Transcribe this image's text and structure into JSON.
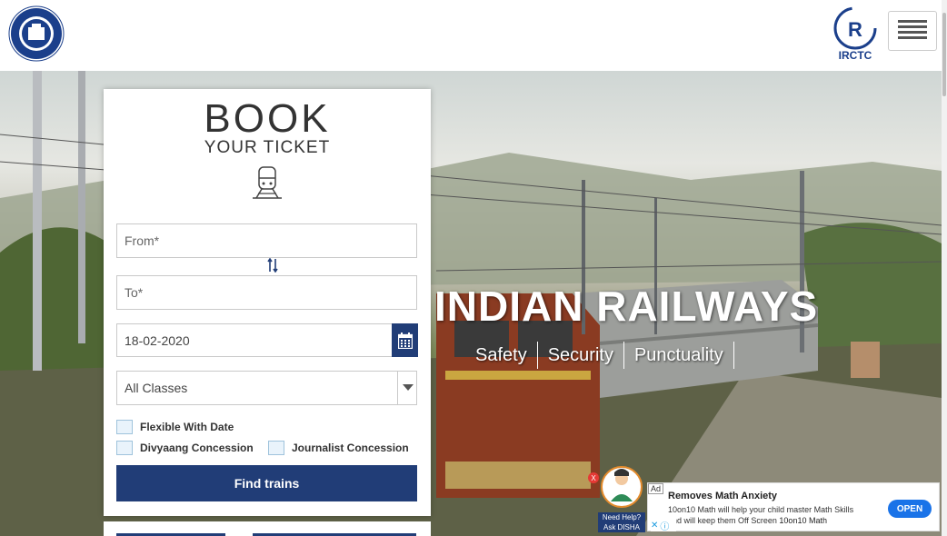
{
  "header": {
    "logo_left": "indian-railways-emblem",
    "logo_right_text": "IRCTC",
    "menu_icon": "hamburger-icon"
  },
  "hero": {
    "title": "INDIAN RAILWAYS",
    "taglines": [
      "Safety",
      "Security",
      "Punctuality"
    ]
  },
  "booking": {
    "title": "BOOK",
    "subtitle": "YOUR TICKET",
    "from_placeholder": "From*",
    "to_placeholder": "To*",
    "date_value": "18-02-2020",
    "class_value": "All Classes",
    "checkboxes": {
      "flexible": "Flexible With Date",
      "divyaang": "Divyaang Concession",
      "journalist": "Journalist Concession"
    },
    "find_button": "Find trains"
  },
  "disha": {
    "close_label": "X",
    "text_line1": "Need Help?",
    "text_line2": "Ask DISHA"
  },
  "ad": {
    "tag": "Ad",
    "title": "Removes Math Anxiety",
    "desc_line1": "10on10 Math will help your child master Math Skills",
    "desc_line2": "and will keep them Off Screen",
    "brand": "10on10 Math",
    "open_label": "OPEN"
  },
  "colors": {
    "brand_navy": "#213d77",
    "checkbox_fill": "#e9f3fb"
  }
}
